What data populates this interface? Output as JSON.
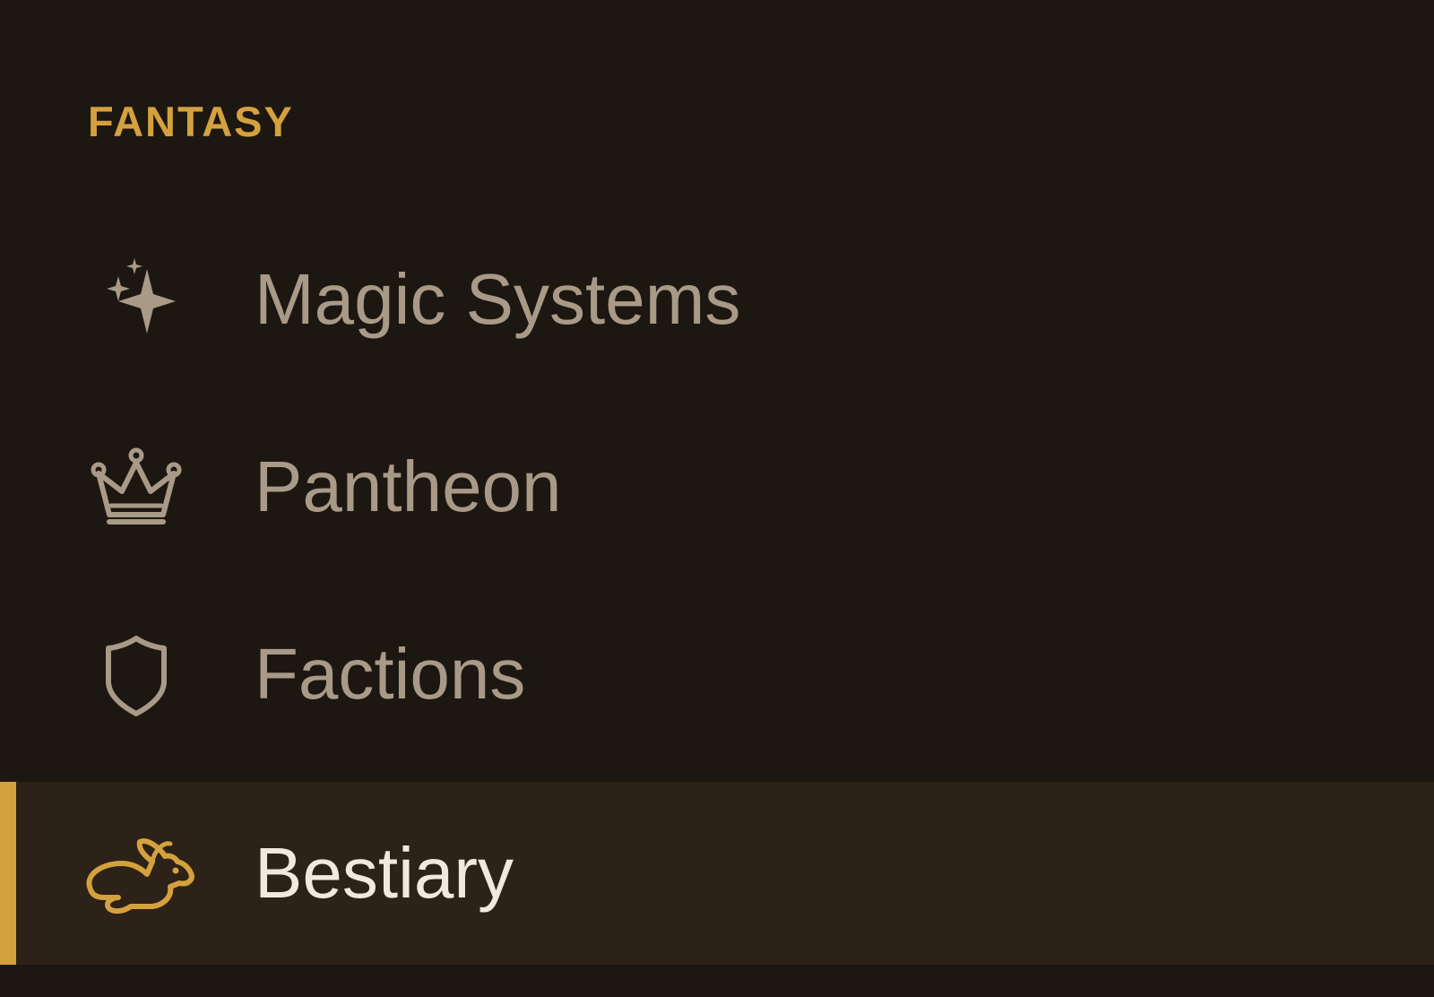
{
  "colors": {
    "background": "#1d1712",
    "accent": "#d4a13e",
    "item_text": "#a99a88",
    "active_text": "#f1e9dc",
    "active_bg": "#2c2217"
  },
  "sidebar": {
    "section_title": "FANTASY",
    "items": [
      {
        "label": "Magic Systems",
        "icon": "sparkles-icon",
        "active": false
      },
      {
        "label": "Pantheon",
        "icon": "crown-icon",
        "active": false
      },
      {
        "label": "Factions",
        "icon": "shield-icon",
        "active": false
      },
      {
        "label": "Bestiary",
        "icon": "rabbit-icon",
        "active": true
      }
    ]
  }
}
